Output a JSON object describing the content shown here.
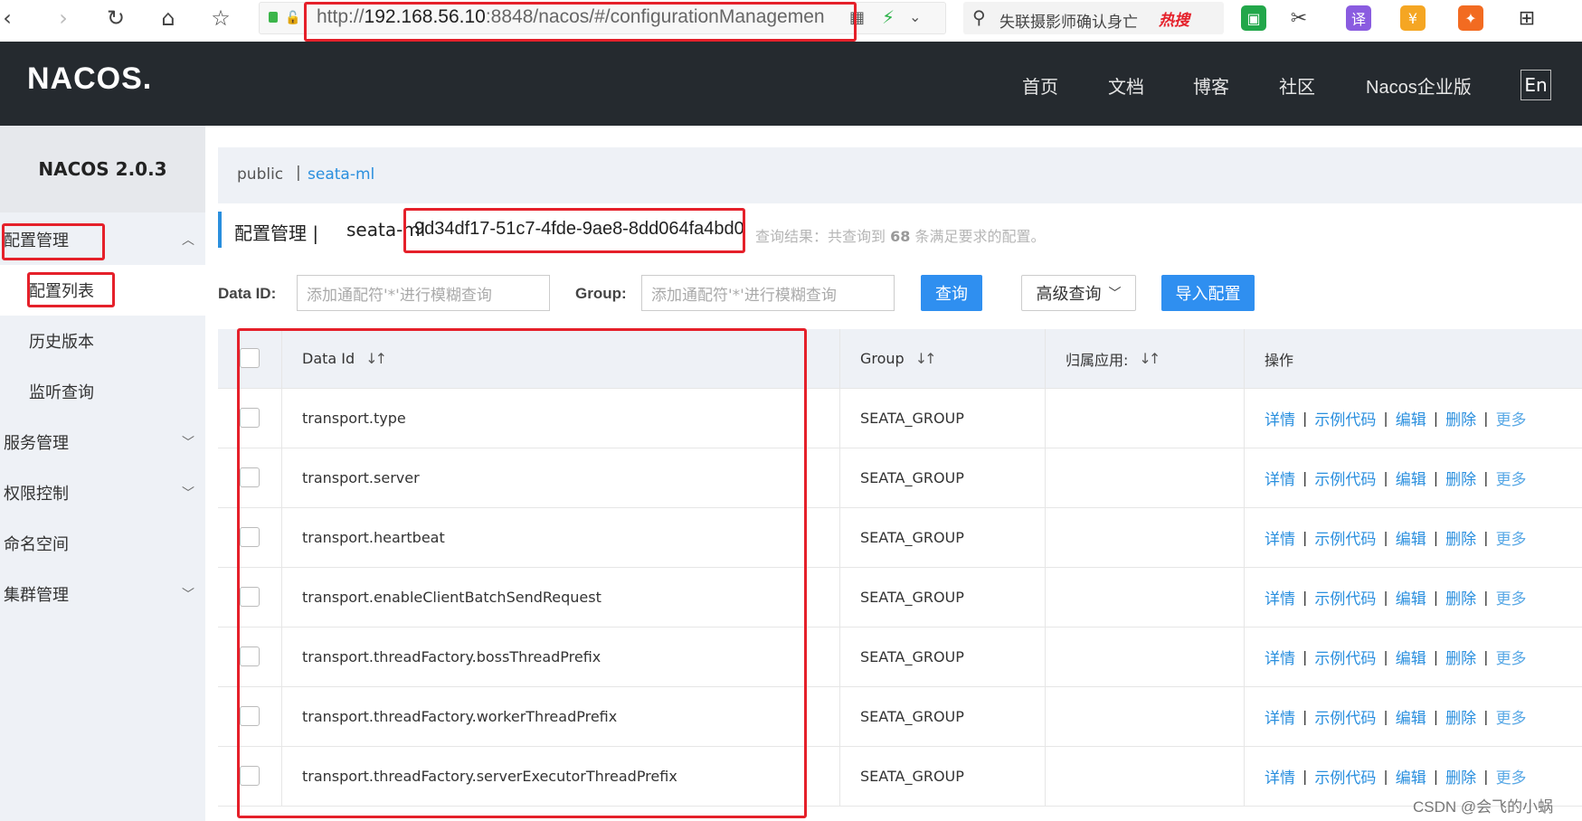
{
  "browser": {
    "url_prefix": "http://",
    "url_host": "192.168.56.10",
    "url_rest": ":8848/nacos/#/configurationManagemen",
    "search_text": "失联摄影师确认身亡",
    "hot_label": "热搜"
  },
  "header": {
    "logo": "NACOS.",
    "nav": [
      "首页",
      "文档",
      "博客",
      "社区",
      "Nacos企业版"
    ],
    "lang": "En"
  },
  "sidebar": {
    "version": "NACOS 2.0.3",
    "items": [
      {
        "label": "配置管理"
      },
      {
        "label": "配置列表"
      },
      {
        "label": "历史版本"
      },
      {
        "label": "监听查询"
      },
      {
        "label": "服务管理"
      },
      {
        "label": "权限控制"
      },
      {
        "label": "命名空间"
      },
      {
        "label": "集群管理"
      }
    ]
  },
  "breadcrumb": {
    "public": "public",
    "sep": "|",
    "namespace": "seata-ml"
  },
  "title": {
    "main": "配置管理 |",
    "namespace": "seata-ml",
    "namespace_id": "9d34df17-51c7-4fde-9ae8-8dd064fa4bd0",
    "result_prefix": "查询结果：共查询到",
    "result_count": "68",
    "result_suffix": "条满足要求的配置。"
  },
  "search": {
    "dataid_label": "Data ID:",
    "dataid_placeholder": "添加通配符'*'进行模糊查询",
    "group_label": "Group:",
    "group_placeholder": "添加通配符'*'进行模糊查询",
    "query_button": "查询",
    "advanced_button": "高级查询",
    "import_button": "导入配置"
  },
  "table": {
    "headers": [
      "Data Id",
      "Group",
      "归属应用:",
      "操作"
    ],
    "ops": [
      "详情",
      "示例代码",
      "编辑",
      "删除",
      "更多"
    ],
    "rows": [
      {
        "data_id": "transport.type",
        "group": "SEATA_GROUP",
        "app": ""
      },
      {
        "data_id": "transport.server",
        "group": "SEATA_GROUP",
        "app": ""
      },
      {
        "data_id": "transport.heartbeat",
        "group": "SEATA_GROUP",
        "app": ""
      },
      {
        "data_id": "transport.enableClientBatchSendRequest",
        "group": "SEATA_GROUP",
        "app": ""
      },
      {
        "data_id": "transport.threadFactory.bossThreadPrefix",
        "group": "SEATA_GROUP",
        "app": ""
      },
      {
        "data_id": "transport.threadFactory.workerThreadPrefix",
        "group": "SEATA_GROUP",
        "app": ""
      },
      {
        "data_id": "transport.threadFactory.serverExecutorThreadPrefix",
        "group": "SEATA_GROUP",
        "app": ""
      }
    ]
  },
  "watermark": "CSDN @会飞的小蜗"
}
